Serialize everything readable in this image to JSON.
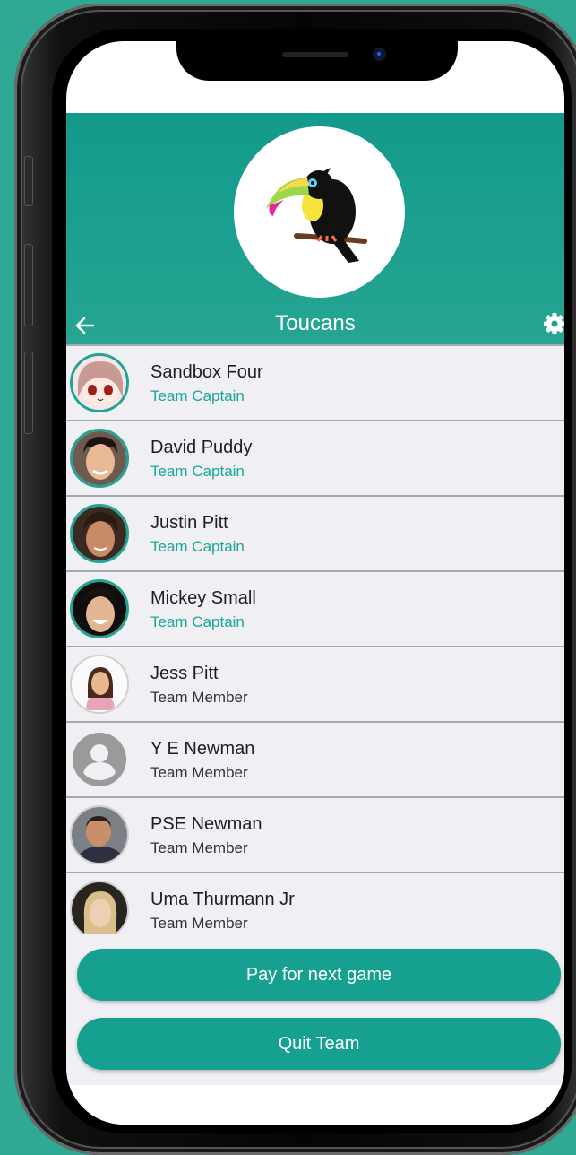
{
  "team": {
    "name": "Toucans",
    "logo_icon": "toucan-logo"
  },
  "nav": {
    "back_icon": "arrow-left-icon",
    "settings_icon": "gear-icon"
  },
  "members": [
    {
      "name": "Sandbox Four",
      "role": "Team Captain",
      "avatar": "anime-avatar"
    },
    {
      "name": "David Puddy",
      "role": "Team Captain",
      "avatar": "photo-avatar"
    },
    {
      "name": "Justin Pitt",
      "role": "Team Captain",
      "avatar": "photo-avatar"
    },
    {
      "name": "Mickey Small",
      "role": "Team Captain",
      "avatar": "photo-avatar"
    },
    {
      "name": "Jess Pitt",
      "role": "Team Member",
      "avatar": "photo-avatar"
    },
    {
      "name": "Y E Newman",
      "role": "Team Member",
      "avatar": "default-user-icon"
    },
    {
      "name": "PSE Newman",
      "role": "Team Member",
      "avatar": "photo-avatar"
    },
    {
      "name": "Uma Thurmann Jr",
      "role": "Team Member",
      "avatar": "photo-avatar"
    }
  ],
  "actions": {
    "pay_label": "Pay for next game",
    "quit_label": "Quit Team"
  },
  "colors": {
    "accent": "#16a08f",
    "header_top": "#129a8c",
    "background": "#2fa894",
    "captain_text": "#1aa896"
  }
}
